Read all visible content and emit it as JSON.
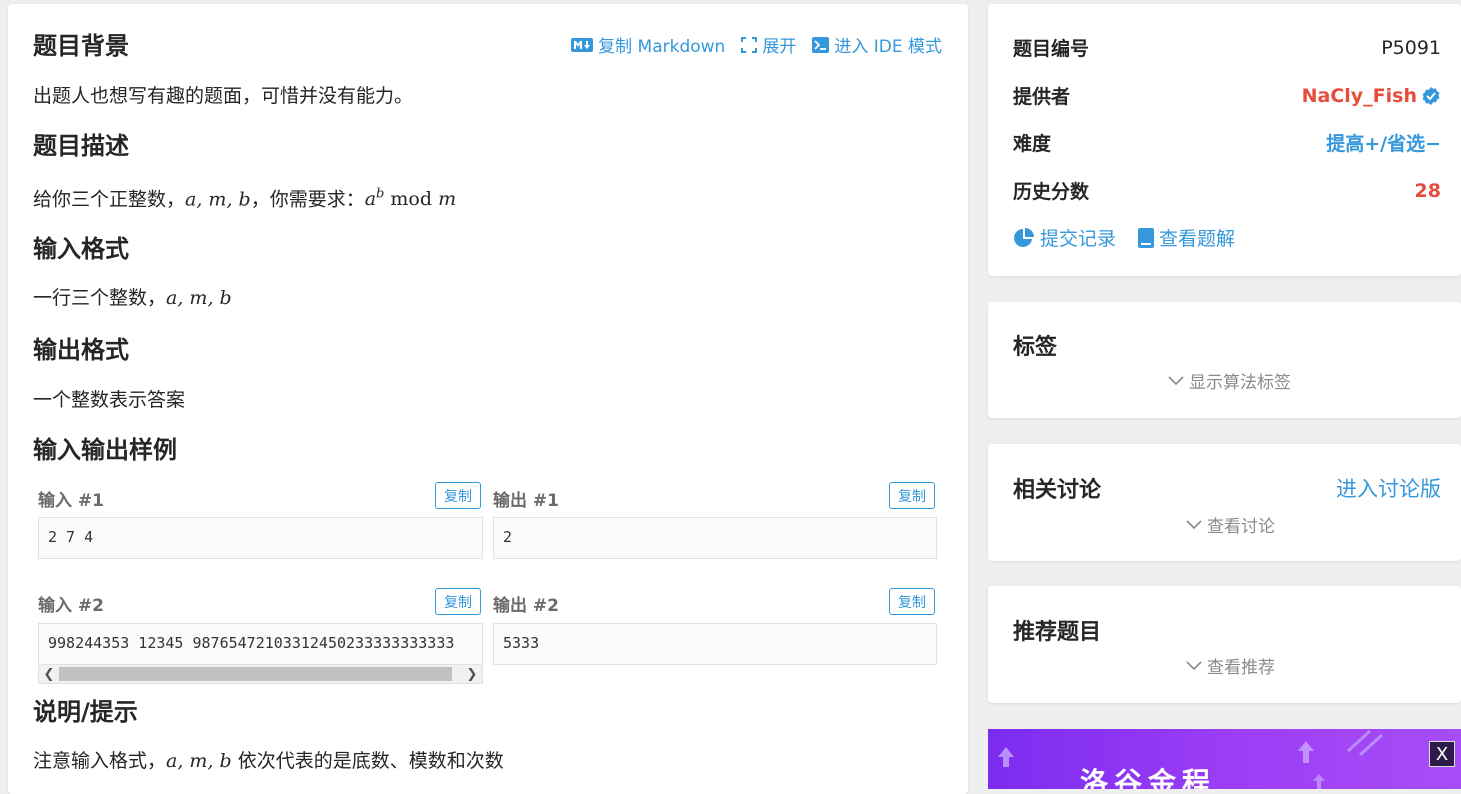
{
  "toolbar": {
    "copy_markdown": "复制 Markdown",
    "expand": "展开",
    "ide_mode": "进入 IDE 模式"
  },
  "problem": {
    "background_title": "题目背景",
    "background_text": "出题人也想写有趣的题面，可惜并没有能力。",
    "description_title": "题目描述",
    "description_prefix": "给你三个正整数，",
    "description_vars": "a, m, b",
    "description_middle": "，你需要求：",
    "formula_base": "a",
    "formula_exp": "b",
    "formula_mod": "mod",
    "formula_m": "m",
    "input_title": "输入格式",
    "input_prefix": "一行三个整数，",
    "input_vars": "a, m, b",
    "output_title": "输出格式",
    "output_text": "一个整数表示答案",
    "samples_title": "输入输出样例",
    "hint_title": "说明/提示",
    "hint_prefix": "注意输入格式，",
    "hint_vars": "a, m, b",
    "hint_suffix": " 依次代表的是底数、模数和次数"
  },
  "samples": [
    {
      "input_label": "输入 #1",
      "output_label": "输出 #1",
      "input": "2 7 4",
      "output": "2",
      "copy": "复制"
    },
    {
      "input_label": "输入 #2",
      "output_label": "输出 #2",
      "input": "998244353 12345 98765472103312450233333333333",
      "output": "5333",
      "copy": "复制"
    }
  ],
  "info": {
    "id_label": "题目编号",
    "id_value": "P5091",
    "provider_label": "提供者",
    "provider_value": "NaCly_Fish",
    "difficulty_label": "难度",
    "difficulty_value": "提高+/省选−",
    "score_label": "历史分数",
    "score_value": "28",
    "submissions_link": "提交记录",
    "solutions_link": "查看题解"
  },
  "tags": {
    "title": "标签",
    "toggle": "显示算法标签"
  },
  "discussion": {
    "title": "相关讨论",
    "enter": "进入讨论版",
    "toggle": "查看讨论"
  },
  "recommend": {
    "title": "推荐题目",
    "toggle": "查看推荐"
  },
  "banner": {
    "text": "洛谷金程",
    "close": "X"
  },
  "colors": {
    "accent": "#3498db",
    "provider": "#e74c3c",
    "score": "#e74c3c"
  }
}
